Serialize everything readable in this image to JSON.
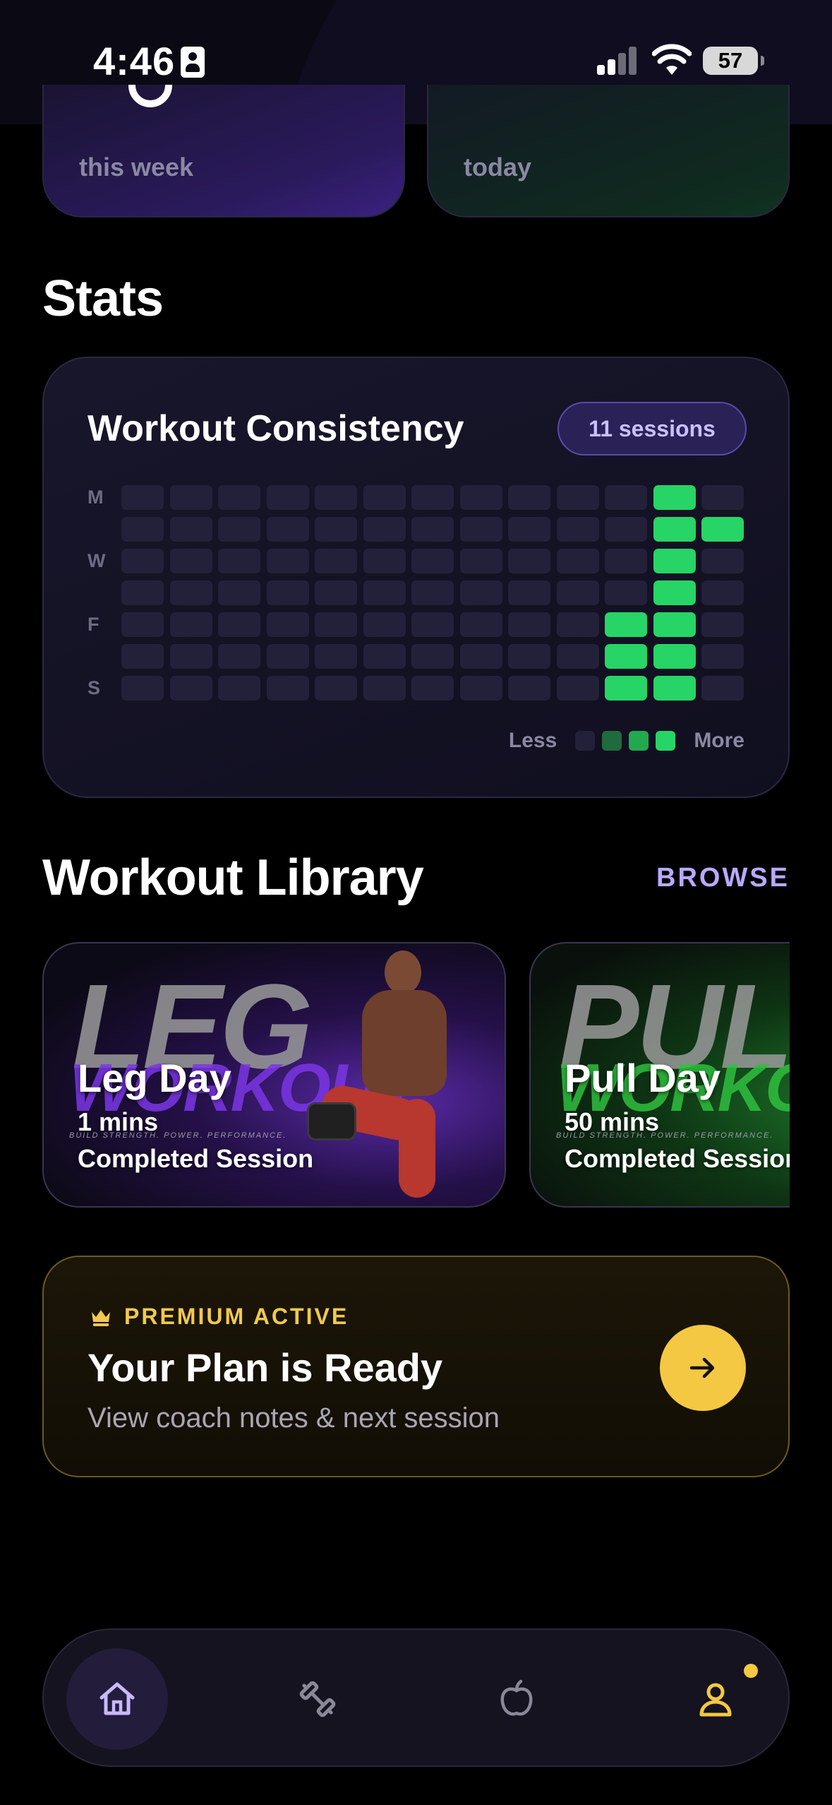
{
  "status_bar": {
    "time": "4:46",
    "battery": "57"
  },
  "summary_cards": [
    {
      "label": "this week"
    },
    {
      "label": "today"
    }
  ],
  "stats": {
    "section_title": "Stats",
    "card_title": "Workout Consistency",
    "sessions_badge": "11 sessions",
    "day_labels": [
      "M",
      "",
      "W",
      "",
      "F",
      "",
      "S"
    ],
    "legend_less": "Less",
    "legend_more": "More",
    "heatmap_levels": [
      [
        0,
        0,
        0,
        0,
        0,
        0,
        0,
        0,
        0,
        0,
        0,
        3,
        0
      ],
      [
        0,
        0,
        0,
        0,
        0,
        0,
        0,
        0,
        0,
        0,
        0,
        3,
        3
      ],
      [
        0,
        0,
        0,
        0,
        0,
        0,
        0,
        0,
        0,
        0,
        0,
        3,
        0
      ],
      [
        0,
        0,
        0,
        0,
        0,
        0,
        0,
        0,
        0,
        0,
        0,
        3,
        0
      ],
      [
        0,
        0,
        0,
        0,
        0,
        0,
        0,
        0,
        0,
        0,
        3,
        3,
        0
      ],
      [
        0,
        0,
        0,
        0,
        0,
        0,
        0,
        0,
        0,
        0,
        3,
        3,
        0
      ],
      [
        0,
        0,
        0,
        0,
        0,
        0,
        0,
        0,
        0,
        0,
        3,
        3,
        0
      ]
    ]
  },
  "library": {
    "section_title": "Workout Library",
    "browse_label": "BROWSE",
    "cards": [
      {
        "bg_word_1": "LEG",
        "bg_word_2": "WORKOUT",
        "tagline": "BUILD STRENGTH. POWER. PERFORMANCE.",
        "title": "Leg Day",
        "duration": "1 mins",
        "status": "Completed Session"
      },
      {
        "bg_word_1": "PULL",
        "bg_word_2": "WORKOUT",
        "tagline": "BUILD STRENGTH. POWER. PERFORMANCE.",
        "title": "Pull Day",
        "duration": "50 mins",
        "status": "Completed Session"
      }
    ]
  },
  "premium": {
    "label": "PREMIUM ACTIVE",
    "title": "Your Plan is Ready",
    "subtitle": "View coach notes & next session"
  },
  "bottom_nav": {
    "items": [
      {
        "icon": "home-icon",
        "active": true
      },
      {
        "icon": "dumbbell-icon",
        "active": false
      },
      {
        "icon": "apple-icon",
        "active": false
      },
      {
        "icon": "profile-icon",
        "active": false,
        "badge": true
      }
    ]
  },
  "colors": {
    "accent": "#b9a9ff",
    "heat_high": "#27d466",
    "heat_empty": "#23213a",
    "premium_gold": "#f4c842"
  }
}
